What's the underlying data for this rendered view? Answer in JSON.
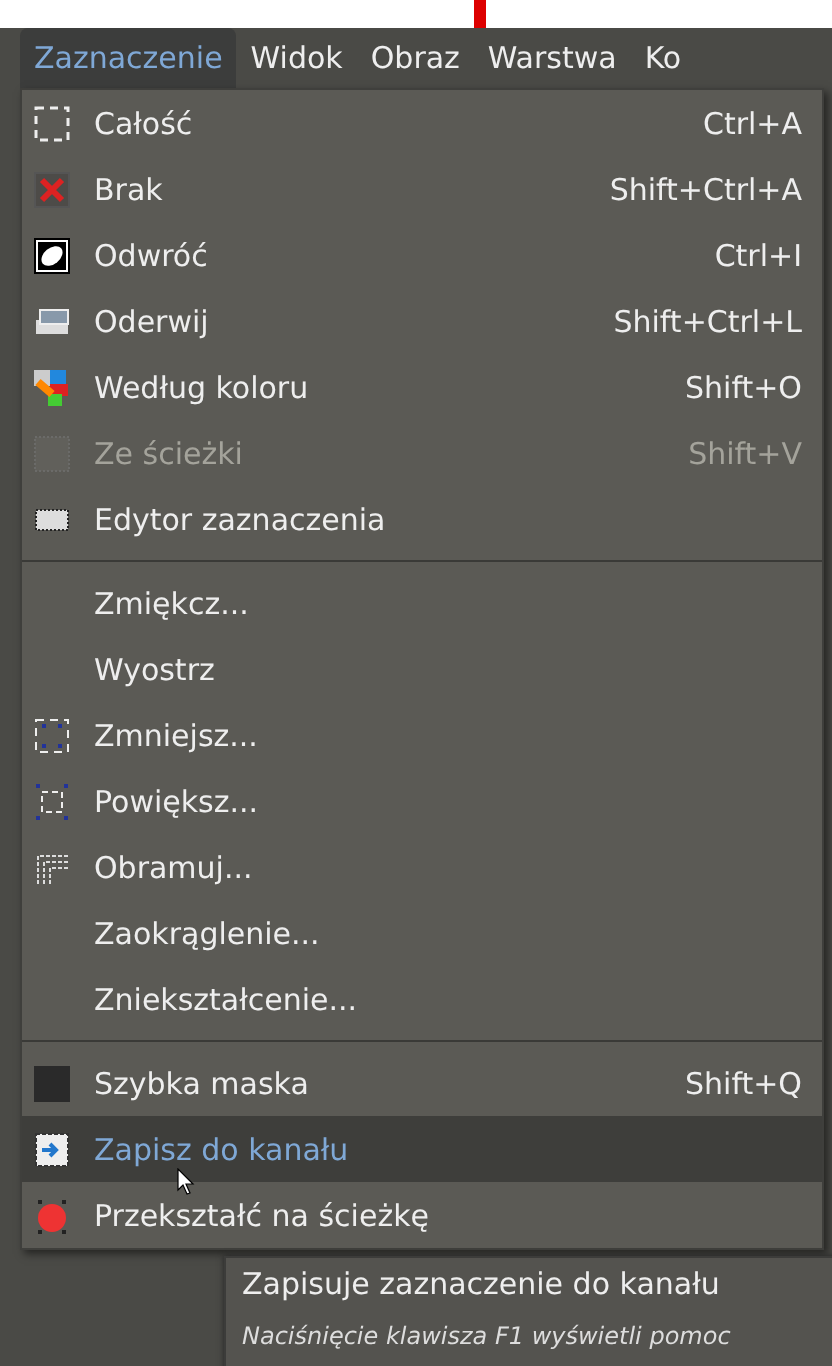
{
  "menubar": [
    {
      "label": "Zaznaczenie",
      "selected": true
    },
    {
      "label": "Widok",
      "selected": false
    },
    {
      "label": "Obraz",
      "selected": false
    },
    {
      "label": "Warstwa",
      "selected": false
    },
    {
      "label": "Ko",
      "selected": false
    }
  ],
  "menu": [
    {
      "kind": "item",
      "label": "Całość",
      "shortcut": "Ctrl+A",
      "disabled": false,
      "selected": false
    },
    {
      "kind": "item",
      "label": "Brak",
      "shortcut": "Shift+Ctrl+A",
      "disabled": false,
      "selected": false
    },
    {
      "kind": "item",
      "label": "Odwróć",
      "shortcut": "Ctrl+I",
      "disabled": false,
      "selected": false
    },
    {
      "kind": "item",
      "label": "Oderwij",
      "shortcut": "Shift+Ctrl+L",
      "disabled": false,
      "selected": false
    },
    {
      "kind": "item",
      "label": "Według koloru",
      "shortcut": "Shift+O",
      "disabled": false,
      "selected": false
    },
    {
      "kind": "item",
      "label": "Ze ścieżki",
      "shortcut": "Shift+V",
      "disabled": true,
      "selected": false
    },
    {
      "kind": "item",
      "label": "Edytor zaznaczenia",
      "disabled": false,
      "selected": false
    },
    {
      "kind": "separator"
    },
    {
      "kind": "item",
      "label": "Zmiękcz...",
      "disabled": false,
      "selected": false
    },
    {
      "kind": "item",
      "label": "Wyostrz",
      "disabled": false,
      "selected": false
    },
    {
      "kind": "item",
      "label": "Zmniejsz...",
      "disabled": false,
      "selected": false
    },
    {
      "kind": "item",
      "label": "Powiększ...",
      "disabled": false,
      "selected": false
    },
    {
      "kind": "item",
      "label": "Obramuj...",
      "disabled": false,
      "selected": false
    },
    {
      "kind": "item",
      "label": "Zaokrąglenie...",
      "disabled": false,
      "selected": false
    },
    {
      "kind": "item",
      "label": "Zniekształcenie...",
      "disabled": false,
      "selected": false
    },
    {
      "kind": "separator"
    },
    {
      "kind": "item",
      "label": "Szybka maska",
      "shortcut": "Shift+Q",
      "disabled": false,
      "selected": false
    },
    {
      "kind": "item",
      "label": "Zapisz do kanału",
      "disabled": false,
      "selected": true
    },
    {
      "kind": "item",
      "label": "Przekształć na ścieżkę",
      "disabled": false,
      "selected": false
    }
  ],
  "tooltip": {
    "title": "Zapisuje zaznaczenie do kanału",
    "hint": "Naciśnięcie klawisza F1 wyświetli pomoc"
  }
}
